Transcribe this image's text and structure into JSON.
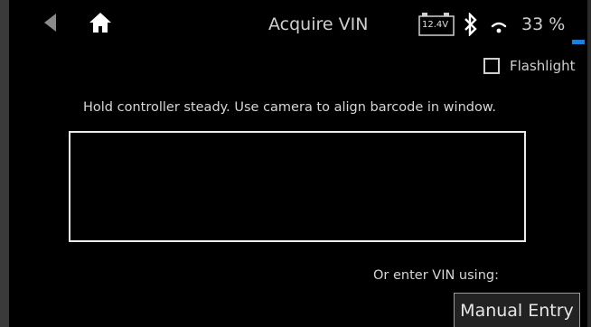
{
  "header": {
    "title": "Acquire VIN",
    "battery_voltage": "12.4V",
    "battery_percent": "33 %",
    "battery_level": 0.33,
    "icons": [
      "back-arrow-icon",
      "home-icon",
      "battery-icon",
      "bluetooth-icon",
      "wifi-icon"
    ]
  },
  "flashlight": {
    "label": "Flashlight",
    "checked": false
  },
  "instructions": "Hold controller steady. Use camera to align barcode in window.",
  "alt_entry": {
    "prompt": "Or enter VIN using:",
    "button_label": "Manual Entry"
  },
  "colors": {
    "background": "#000000",
    "text": "#d6d6d6",
    "battery_bar": "#1e7fd6",
    "frame": "#3a3a3a"
  }
}
